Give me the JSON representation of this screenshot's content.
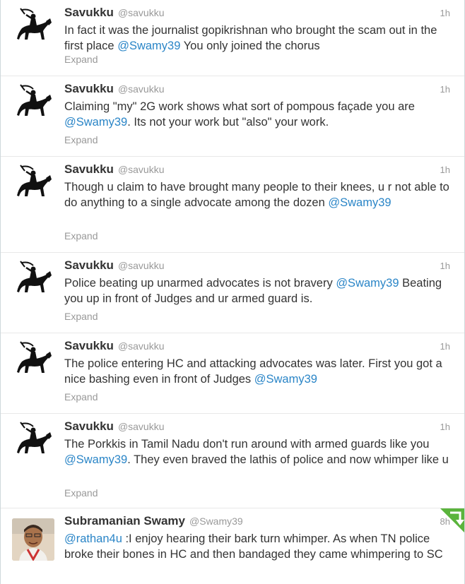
{
  "tweets": [
    {
      "fullname": "Savukku",
      "username": "@savukku",
      "time": "1h",
      "text_before": "In fact it was the journalist gopikrishnan who brought the scam out in the first place ",
      "mention": "@Swamy39",
      "text_after": " You only joined the chorus",
      "expand": "Expand"
    },
    {
      "fullname": "Savukku",
      "username": "@savukku",
      "time": "1h",
      "text_before": "Claiming \"my\" 2G work shows what sort of pompous façade you are ",
      "mention": "@Swamy39",
      "text_after": ". Its not your work but \"also\" your work.",
      "expand": "Expand"
    },
    {
      "fullname": "Savukku",
      "username": "@savukku",
      "time": "1h",
      "text_before": "Though u claim to have brought many people to their knees, u r not able to do anything to a single advocate among the dozen ",
      "mention": "@Swamy39",
      "text_after": "",
      "expand": "Expand"
    },
    {
      "fullname": "Savukku",
      "username": "@savukku",
      "time": "1h",
      "text_before": "Police beating up unarmed advocates is not bravery ",
      "mention": "@Swamy39",
      "text_after": " Beating you up in front of Judges and ur armed guard is.",
      "expand": "Expand"
    },
    {
      "fullname": "Savukku",
      "username": "@savukku",
      "time": "1h",
      "text_before": "The police entering HC and attacking advocates was later. First you got a nice bashing even in front of Judges ",
      "mention": "@Swamy39",
      "text_after": "",
      "expand": "Expand"
    },
    {
      "fullname": "Savukku",
      "username": "@savukku",
      "time": "1h",
      "text_before": "The Porkkis in Tamil Nadu don't run around with armed guards like you ",
      "mention": "@Swamy39",
      "text_after": ". They even braved the lathis of police and now whimper like u",
      "expand": "Expand"
    },
    {
      "fullname": "Subramanian Swamy",
      "username": "@Swamy39",
      "time": "8h",
      "text_before": "",
      "mention": "@rathan4u",
      "text_after": " :I enjoy hearing their bark turn whimper. As when TN police broke their bones in HC and then bandaged they came whimpering to SC",
      "expand": ""
    }
  ],
  "icons": {
    "savukku_avatar": "horse-rider-silhouette-icon",
    "swamy_avatar": "profile-photo",
    "retweeted_corner": "retweet-corner-icon"
  },
  "colors": {
    "mention": "#2a85c7",
    "muted": "#999999",
    "corner": "#5ab43c"
  }
}
